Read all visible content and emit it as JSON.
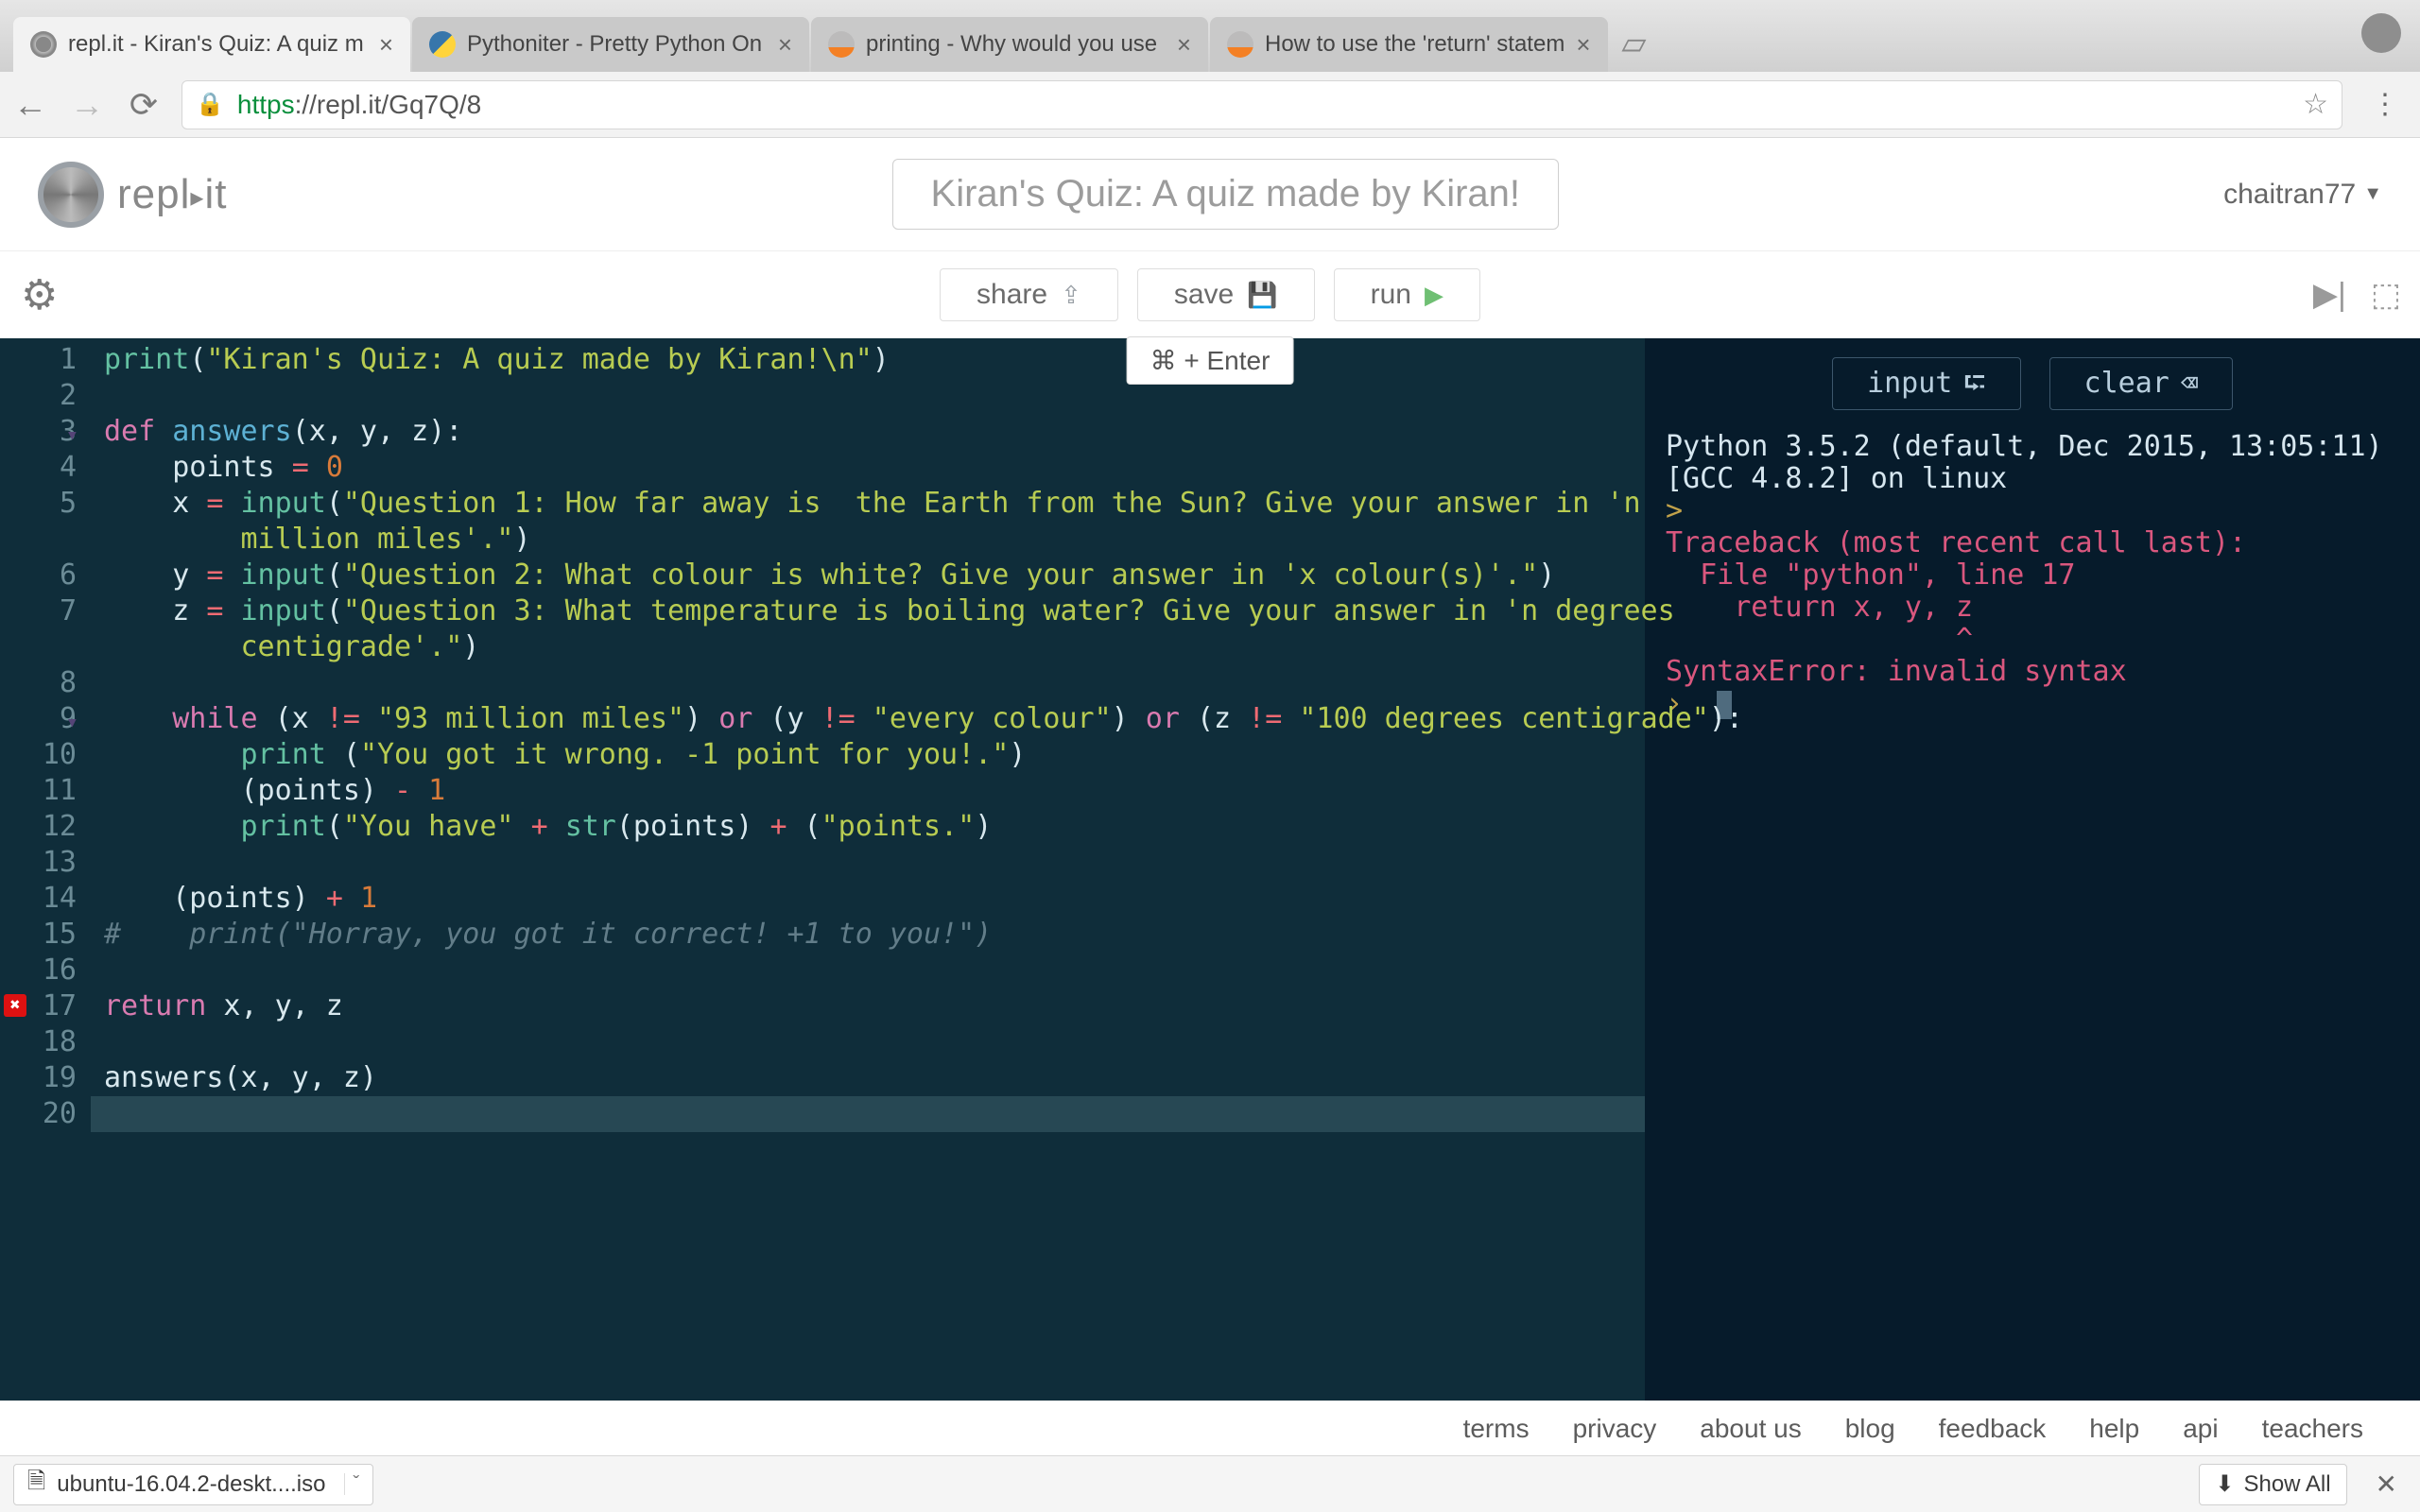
{
  "browser": {
    "tabs": [
      {
        "title": "repl.it - Kiran's Quiz: A quiz m",
        "active": true,
        "favicon": "repl"
      },
      {
        "title": "Pythoniter - Pretty Python On",
        "active": false,
        "favicon": "py"
      },
      {
        "title": "printing - Why would you use",
        "active": false,
        "favicon": "so"
      },
      {
        "title": "How to use the 'return' statem",
        "active": false,
        "favicon": "so"
      }
    ],
    "url_scheme": "https",
    "url_host_path": "://repl.it/Gq7Q/8"
  },
  "app": {
    "logo_text": "repl it",
    "title": "Kiran's Quiz: A quiz made by Kiran!",
    "username": "chaitran77"
  },
  "toolbar": {
    "share": "share",
    "save": "save",
    "run": "run",
    "shortcut": "⌘ + Enter"
  },
  "console_buttons": {
    "input": "input",
    "clear": "clear"
  },
  "editor": {
    "error_line": 17,
    "lines": 20,
    "code_tokens": [
      [
        [
          "bl",
          "print"
        ],
        [
          "id",
          "("
        ],
        [
          "str",
          "\"Kiran's Quiz: A quiz made by Kiran!\\n\""
        ],
        [
          "id",
          ")"
        ]
      ],
      [],
      [
        [
          "kw",
          "def "
        ],
        [
          "fn",
          "answers"
        ],
        [
          "id",
          "(x, y, z):"
        ]
      ],
      [
        [
          "id",
          "    points "
        ],
        [
          "op",
          "= "
        ],
        [
          "num",
          "0"
        ]
      ],
      [
        [
          "id",
          "    x "
        ],
        [
          "op",
          "= "
        ],
        [
          "bl",
          "input"
        ],
        [
          "id",
          "("
        ],
        [
          "str",
          "\"Question 1: How far away is  the Earth from the Sun? Give your answer in 'n "
        ]
      ],
      [
        [
          "str",
          "        million miles'.\""
        ],
        [
          "id",
          ")"
        ]
      ],
      [
        [
          "id",
          "    y "
        ],
        [
          "op",
          "= "
        ],
        [
          "bl",
          "input"
        ],
        [
          "id",
          "("
        ],
        [
          "str",
          "\"Question 2: What colour is white? Give your answer in 'x colour(s)'.\""
        ],
        [
          "id",
          ")"
        ]
      ],
      [
        [
          "id",
          "    z "
        ],
        [
          "op",
          "= "
        ],
        [
          "bl",
          "input"
        ],
        [
          "id",
          "("
        ],
        [
          "str",
          "\"Question 3: What temperature is boiling water? Give your answer in 'n degrees "
        ]
      ],
      [
        [
          "str",
          "        centigrade'.\""
        ],
        [
          "id",
          ")"
        ]
      ],
      [],
      [
        [
          "id",
          "    "
        ],
        [
          "kw",
          "while"
        ],
        [
          "id",
          " (x "
        ],
        [
          "op",
          "!="
        ],
        [
          "id",
          " "
        ],
        [
          "str",
          "\"93 million miles\""
        ],
        [
          "id",
          ") "
        ],
        [
          "kw",
          "or"
        ],
        [
          "id",
          " (y "
        ],
        [
          "op",
          "!="
        ],
        [
          "id",
          " "
        ],
        [
          "str",
          "\"every colour\""
        ],
        [
          "id",
          ") "
        ],
        [
          "kw",
          "or"
        ],
        [
          "id",
          " (z "
        ],
        [
          "op",
          "!="
        ],
        [
          "id",
          " "
        ],
        [
          "str",
          "\"100 degrees centigrade\""
        ],
        [
          "id",
          "):"
        ]
      ],
      [
        [
          "id",
          "        "
        ],
        [
          "bl",
          "print"
        ],
        [
          "id",
          " ("
        ],
        [
          "str",
          "\"You got it wrong. -1 point for you!.\""
        ],
        [
          "id",
          ")"
        ]
      ],
      [
        [
          "id",
          "        (points) "
        ],
        [
          "op",
          "- "
        ],
        [
          "num",
          "1"
        ]
      ],
      [
        [
          "id",
          "        "
        ],
        [
          "bl",
          "print"
        ],
        [
          "id",
          "("
        ],
        [
          "str",
          "\"You have\""
        ],
        [
          "id",
          " "
        ],
        [
          "op",
          "+"
        ],
        [
          "id",
          " "
        ],
        [
          "bl",
          "str"
        ],
        [
          "id",
          "(points) "
        ],
        [
          "op",
          "+"
        ],
        [
          "id",
          " ("
        ],
        [
          "str",
          "\"points.\""
        ],
        [
          "id",
          ")"
        ]
      ],
      [],
      [
        [
          "id",
          "    (points) "
        ],
        [
          "op",
          "+ "
        ],
        [
          "num",
          "1"
        ]
      ],
      [
        [
          "cm",
          "#    print(\"Horray, you got it correct! +1 to you!\")"
        ]
      ],
      [],
      [
        [
          "kw",
          "return"
        ],
        [
          "id",
          " x, y, z"
        ]
      ],
      [],
      [
        [
          "id",
          "answers(x, y, z)"
        ]
      ],
      []
    ],
    "display_line_numbers": [
      1,
      2,
      3,
      4,
      5,
      "",
      6,
      7,
      "",
      8,
      9,
      10,
      11,
      12,
      13,
      14,
      15,
      16,
      17,
      18,
      19,
      20
    ]
  },
  "console": {
    "lines": [
      {
        "cls": "hdr",
        "text": "Python 3.5.2 (default, Dec 2015, 13:05:11)"
      },
      {
        "cls": "hdr",
        "text": "[GCC 4.8.2] on linux"
      },
      {
        "cls": "prompt",
        "text": ">"
      },
      {
        "cls": "err",
        "text": "Traceback (most recent call last):"
      },
      {
        "cls": "err",
        "text": "  File \"python\", line 17"
      },
      {
        "cls": "err",
        "text": "    return x, y, z"
      },
      {
        "cls": "err",
        "text": "                 ^"
      },
      {
        "cls": "err",
        "text": "SyntaxError: invalid syntax"
      }
    ]
  },
  "footer": [
    "terms",
    "privacy",
    "about us",
    "blog",
    "feedback",
    "help",
    "api",
    "teachers"
  ],
  "download": {
    "filename": "ubuntu-16.04.2-deskt....iso",
    "show_all": "Show All"
  }
}
